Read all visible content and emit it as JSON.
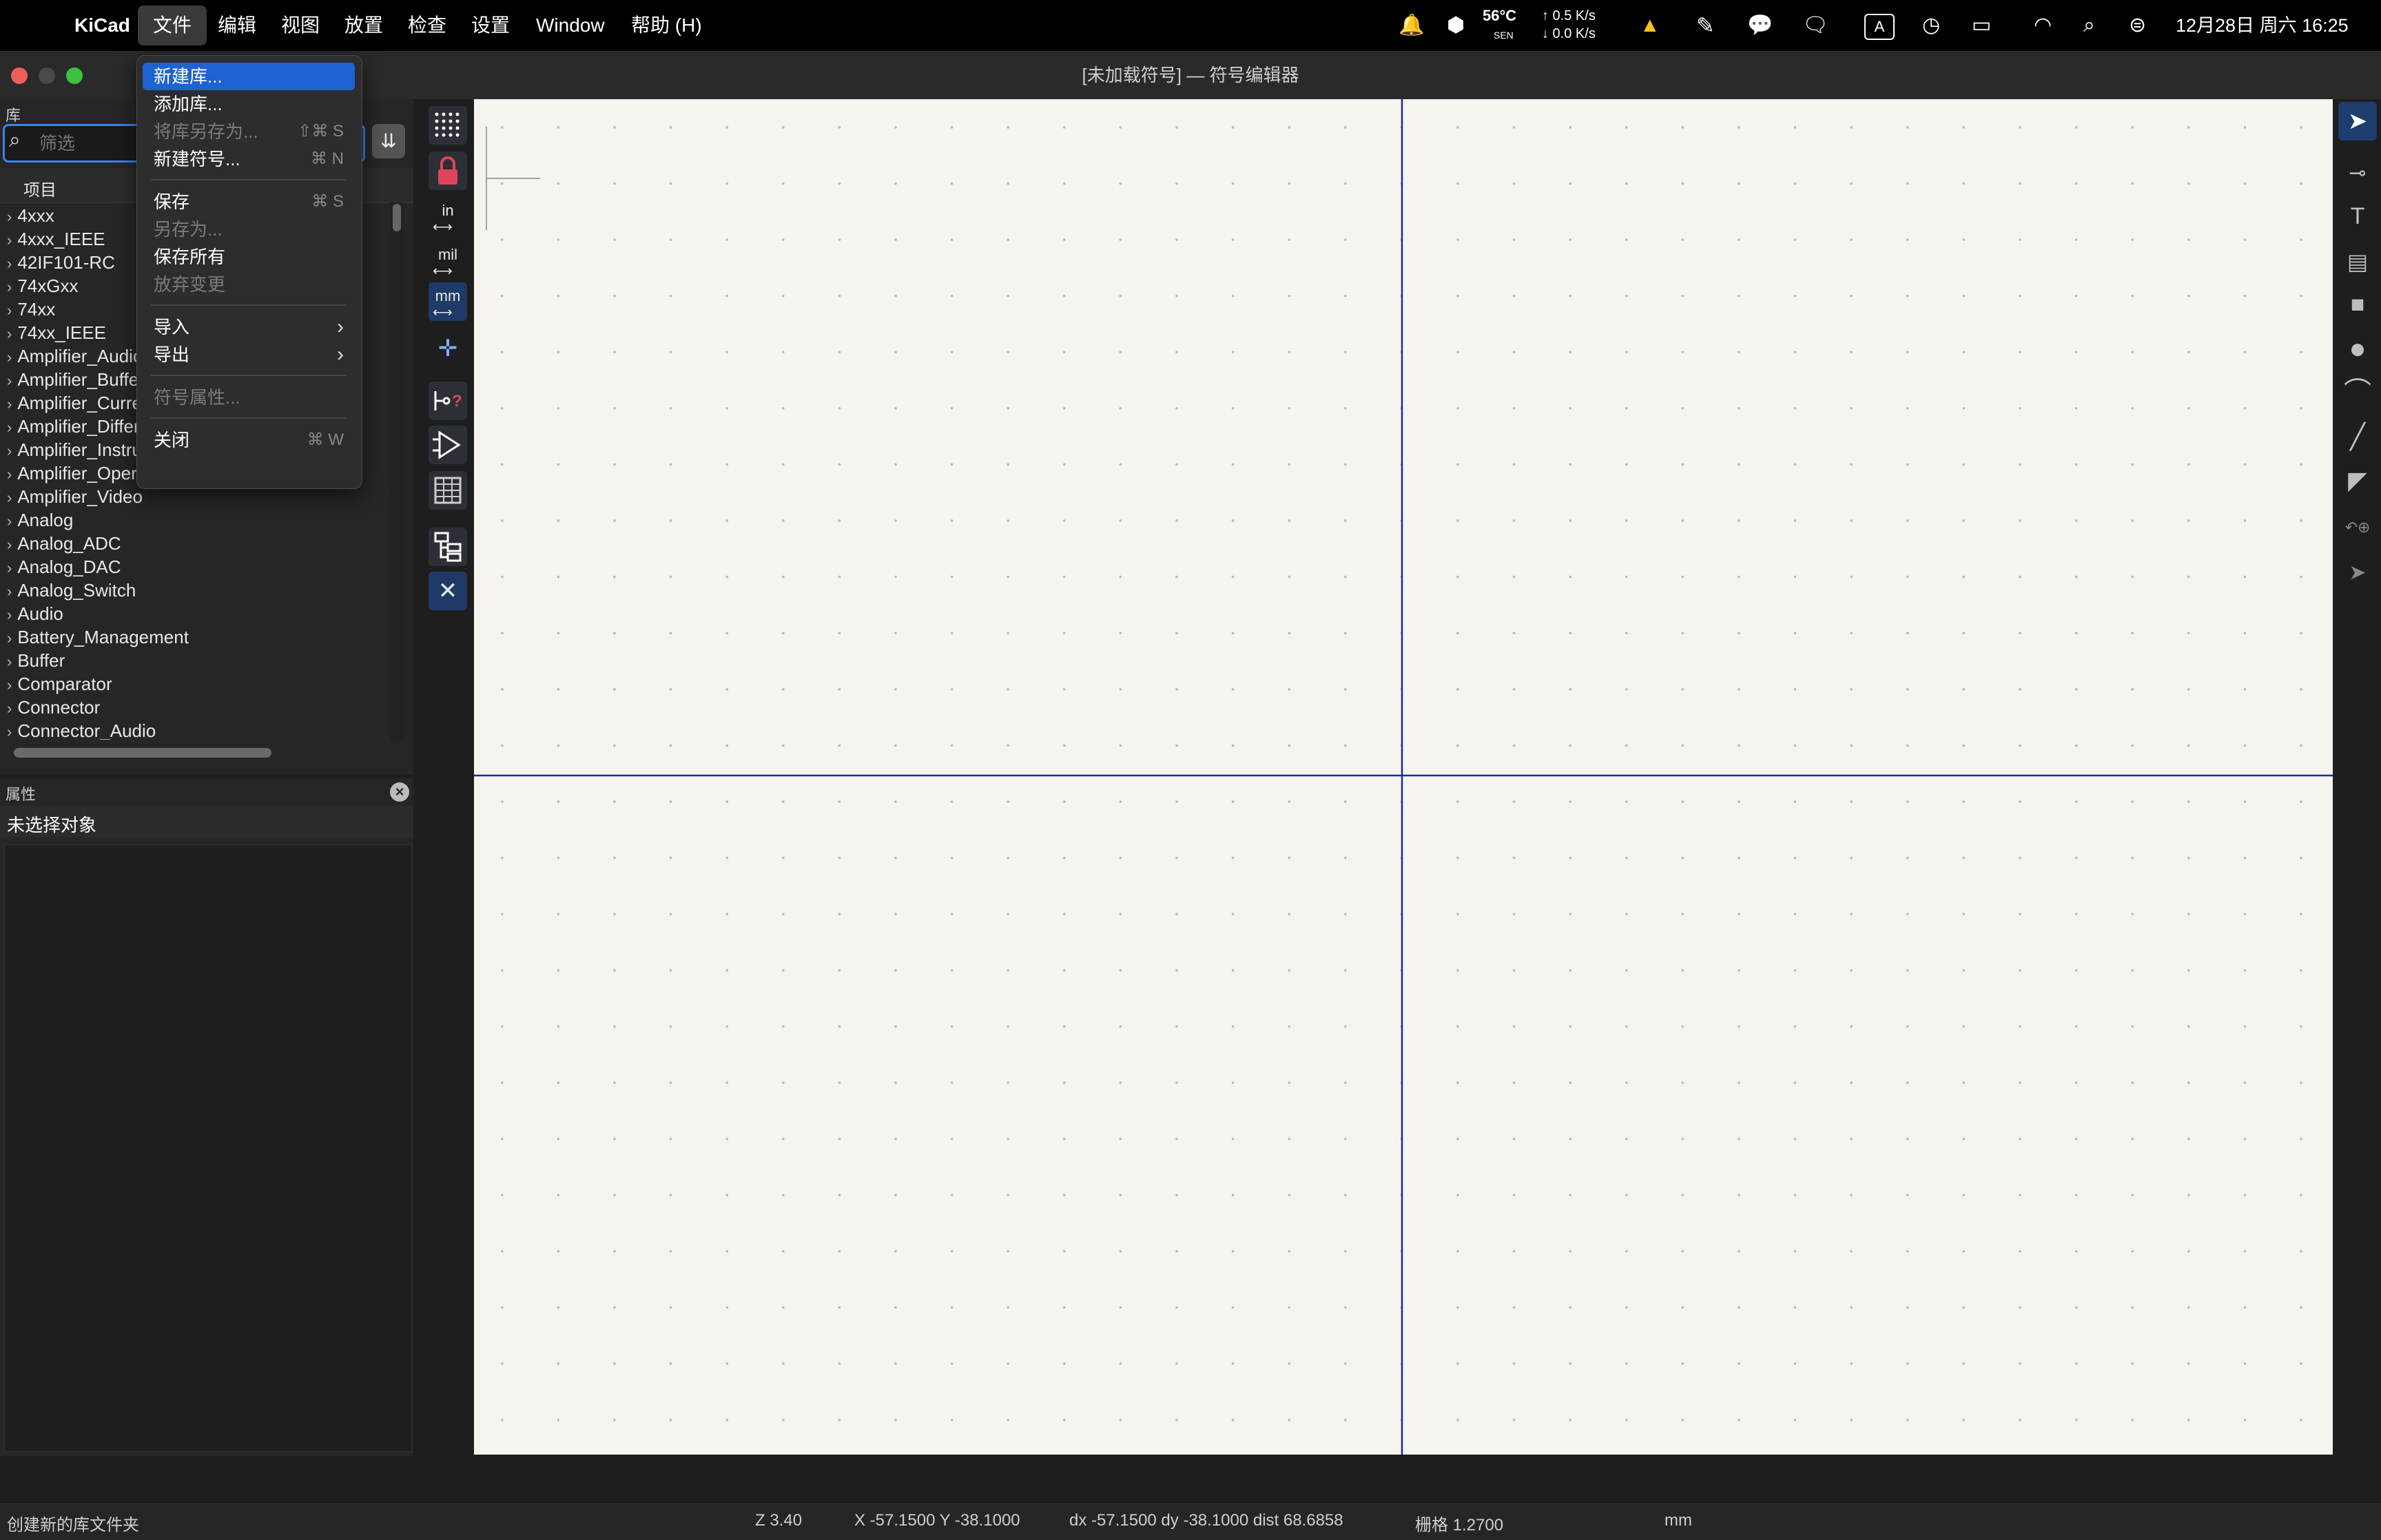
{
  "menubar": {
    "app_name": "KiCad",
    "items": [
      "文件",
      "编辑",
      "视图",
      "放置",
      "检查",
      "设置",
      "Window",
      "帮助 (H)"
    ],
    "active_item": "文件",
    "status": {
      "temperature": "56°C",
      "temp_sub": "SEN",
      "net_up": "↑ 0.5 K/s",
      "net_down": "↓ 0.0 K/s",
      "input_method": "A",
      "datetime": "12月28日 周六  16:25"
    }
  },
  "window": {
    "title": "[未加载符号] — 符号编辑器"
  },
  "library": {
    "panel_title": "库",
    "filter_placeholder": "筛选",
    "column_header": "项目",
    "items": [
      "4xxx",
      "4xxx_IEEE",
      "42IF101-RC",
      "74xGxx",
      "74xx",
      "74xx_IEEE",
      "Amplifier_Audio",
      "Amplifier_Buffer",
      "Amplifier_Current",
      "Amplifier_Difference",
      "Amplifier_Instrumentation",
      "Amplifier_Operational",
      "Amplifier_Video",
      "Analog",
      "Analog_ADC",
      "Analog_DAC",
      "Analog_Switch",
      "Audio",
      "Battery_Management",
      "Buffer",
      "Comparator",
      "Connector",
      "Connector_Audio"
    ]
  },
  "properties": {
    "panel_title": "属性",
    "empty_text": "未选择对象"
  },
  "left_toolbar": {
    "units": [
      "in",
      "mil",
      "mm"
    ],
    "selected_unit": "mm"
  },
  "file_menu": {
    "groups": [
      [
        {
          "label": "新建库...",
          "shortcut": "",
          "enabled": true,
          "highlighted": true
        },
        {
          "label": "添加库...",
          "shortcut": "",
          "enabled": true
        },
        {
          "label": "将库另存为...",
          "shortcut": "⇧⌘ S",
          "enabled": false
        },
        {
          "label": "新建符号...",
          "shortcut": "⌘ N",
          "enabled": true
        }
      ],
      [
        {
          "label": "保存",
          "shortcut": "⌘ S",
          "enabled": true
        },
        {
          "label": "另存为...",
          "shortcut": "",
          "enabled": false
        },
        {
          "label": "保存所有",
          "shortcut": "",
          "enabled": true
        },
        {
          "label": "放弃变更",
          "shortcut": "",
          "enabled": false
        }
      ],
      [
        {
          "label": "导入",
          "shortcut": "",
          "enabled": true,
          "submenu": true
        },
        {
          "label": "导出",
          "shortcut": "",
          "enabled": true,
          "submenu": true
        }
      ],
      [
        {
          "label": "符号属性...",
          "shortcut": "",
          "enabled": false
        }
      ],
      [
        {
          "label": "关闭",
          "shortcut": "⌘ W",
          "enabled": true
        }
      ]
    ]
  },
  "statusbar": {
    "message": "创建新的库文件夹",
    "zoom": "Z 3.40",
    "coords": "X -57.1500  Y -38.1000",
    "delta": "dx -57.1500  dy -38.1000  dist 68.6858",
    "grid": "栅格 1.2700",
    "units": "mm"
  },
  "colors": {
    "canvas_bg": "#f5f4ef",
    "axis_line": "#1a2a9c",
    "accent": "#1f62d2"
  }
}
